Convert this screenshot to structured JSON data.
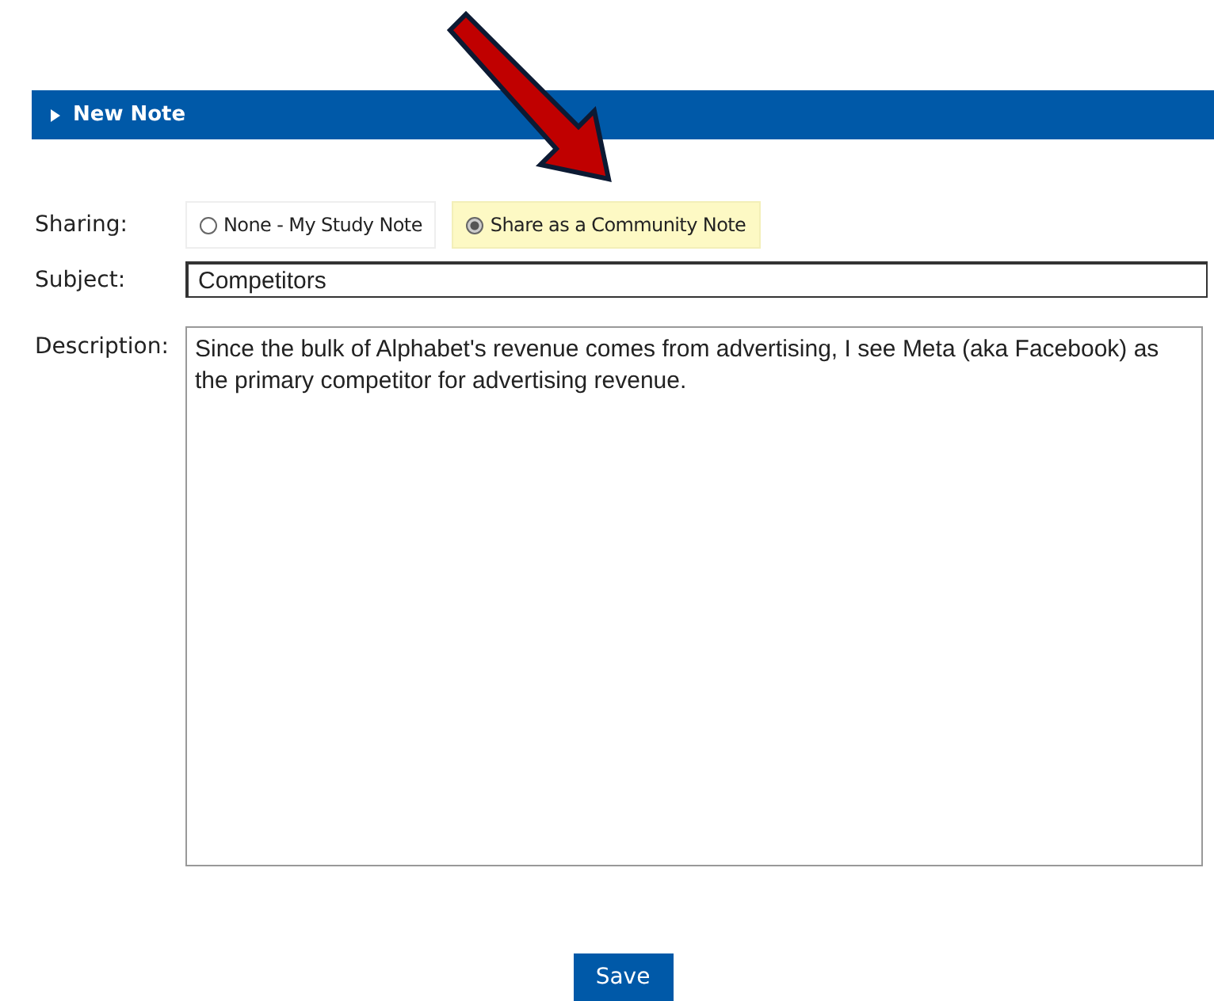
{
  "panel": {
    "title": "New Note",
    "expanded": false
  },
  "sharing": {
    "label": "Sharing:",
    "options": [
      {
        "label": "None - My Study Note",
        "selected": false
      },
      {
        "label": "Share as a Community Note",
        "selected": true
      }
    ]
  },
  "subject": {
    "label": "Subject:",
    "value": "Competitors"
  },
  "description": {
    "label": "Description:",
    "value": "Since the bulk of Alphabet's revenue comes from advertising, I see Meta (aka Facebook) as the primary competitor for advertising revenue."
  },
  "buttons": [
    "Save"
  ]
}
